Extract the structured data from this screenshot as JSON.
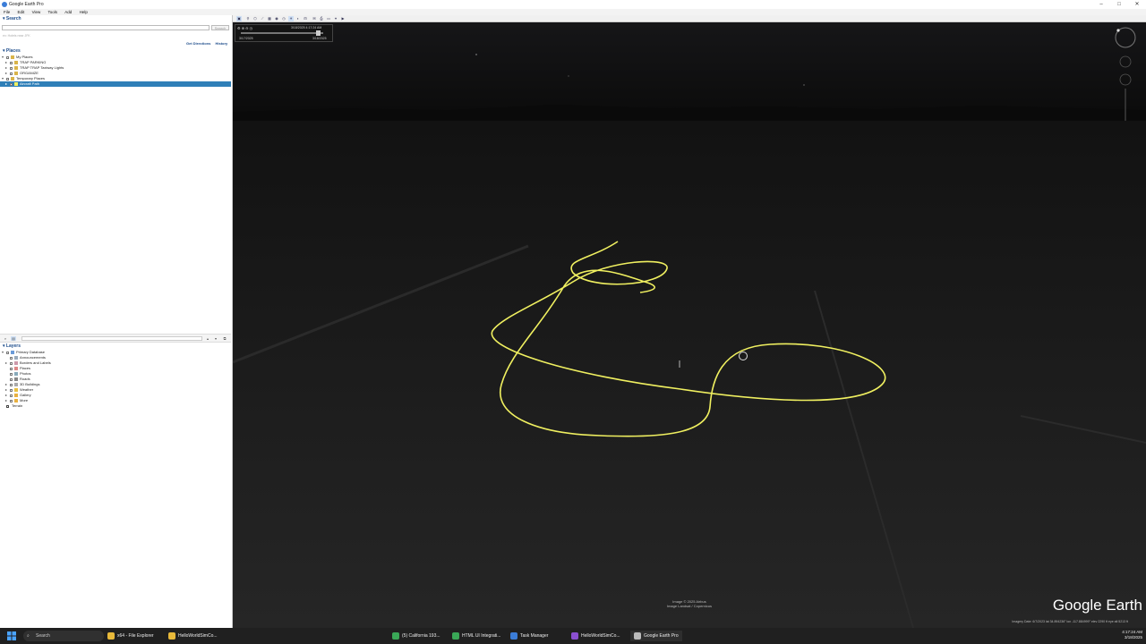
{
  "window": {
    "title": "Google Earth Pro",
    "controls": [
      "–",
      "□",
      "✕"
    ]
  },
  "menu": [
    "File",
    "Edit",
    "View",
    "Tools",
    "Add",
    "Help"
  ],
  "search": {
    "header": "Search",
    "placeholder": "",
    "button": "Search",
    "hint": "ex: Hotels near JFK",
    "links": [
      "Get Directions",
      "History"
    ]
  },
  "places": {
    "header": "Places",
    "items": [
      {
        "label": "My Places",
        "level": 0
      },
      {
        "label": "TRAP PARKING",
        "level": 1
      },
      {
        "label": "TRAP TRAP Taxiway Lights",
        "level": 1
      },
      {
        "label": "ORGANIZE",
        "level": 1
      },
      {
        "label": "Temporary Places",
        "level": 0
      },
      {
        "label": "Aircraft Path",
        "level": 1,
        "selected": true
      }
    ]
  },
  "layers": {
    "header": "Layers",
    "items": [
      {
        "label": "Primary Database",
        "level": 0
      },
      {
        "label": "Announcements",
        "level": 1
      },
      {
        "label": "Borders and Labels",
        "level": 1
      },
      {
        "label": "Places",
        "level": 1
      },
      {
        "label": "Photos",
        "level": 1
      },
      {
        "label": "Roads",
        "level": 1
      },
      {
        "label": "3D Buildings",
        "level": 1
      },
      {
        "label": "Weather",
        "level": 1
      },
      {
        "label": "Gallery",
        "level": 1
      },
      {
        "label": "More",
        "level": 1
      },
      {
        "label": "Terrain",
        "level": 0
      }
    ]
  },
  "timeslider": {
    "range_label": "3/18/2025 4:17:24 AM",
    "start": "3/17/2025",
    "end": "3/18/2025"
  },
  "map": {
    "attribution": [
      "Image © 2025 Airbus",
      "Image Landsat / Copernicus"
    ],
    "logo": "Google Earth",
    "status": "Imagery Date: 6/7/2023    lat 34.894236°  lon -117.884999°  elev 2290 ft    eye alt 5213 ft",
    "colors": {
      "path": "#f0f060",
      "sky": "#141414",
      "ground": "#1c1c1c"
    }
  },
  "taskbar": {
    "search_placeholder": "Search",
    "apps": [
      {
        "label": "x64 - File Explorer",
        "color": "#e8b93a"
      },
      {
        "label": "HelloWorldSimCo...",
        "color": "#e8b93a"
      },
      {
        "label": "(5) California 193...",
        "color": "#3aa757"
      },
      {
        "label": "HTML UI Integrati...",
        "color": "#3aa757"
      },
      {
        "label": "Task Manager",
        "color": "#3b7dd8"
      },
      {
        "label": "HelloWorldSimCo...",
        "color": "#8a4fd0"
      },
      {
        "label": "Google Earth Pro",
        "color": "#bbbbbb"
      }
    ],
    "time": "4:17:24 AM",
    "date": "3/18/2025"
  }
}
